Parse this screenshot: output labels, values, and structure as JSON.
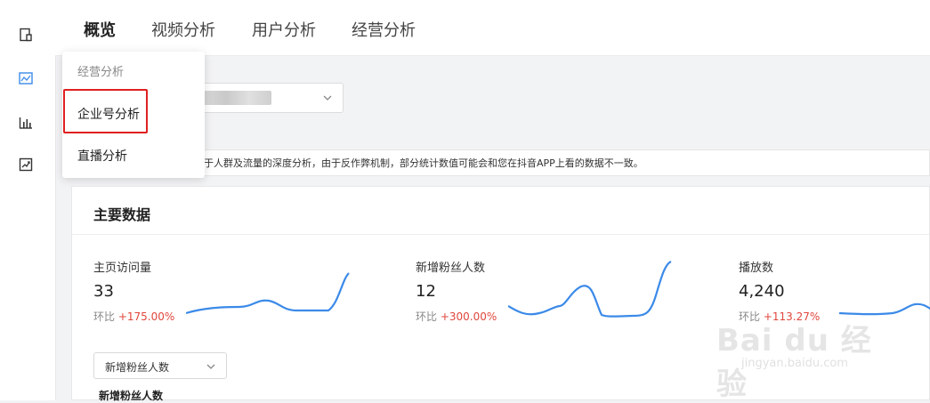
{
  "tabs": [
    "概览",
    "视频分析",
    "用户分析",
    "经营分析"
  ],
  "dropdown": {
    "header": "经营分析",
    "items": [
      "企业号分析",
      "直播分析"
    ]
  },
  "notice": "于人群及流量的深度分析，由于反作弊机制，部分统计数值可能会和您在抖音APP上看的数据不一致。",
  "panel": {
    "title": "主要数据",
    "metrics": [
      {
        "label": "主页访问量",
        "value": "33",
        "compare_label": "环比",
        "compare_value": "+175.00%"
      },
      {
        "label": "新增粉丝人数",
        "value": "12",
        "compare_label": "环比",
        "compare_value": "+300.00%"
      },
      {
        "label": "播放数",
        "value": "4,240",
        "compare_label": "环比",
        "compare_value": "+113.27%"
      }
    ],
    "select_value": "新增粉丝人数",
    "chart_title": "新增粉丝人数"
  },
  "watermark": {
    "main": "Bai du 经验",
    "sub": "jingyan.baidu.com"
  },
  "colors": {
    "accent": "#3b8ae8",
    "increase": "#e0463c",
    "highlight": "#e02020"
  }
}
